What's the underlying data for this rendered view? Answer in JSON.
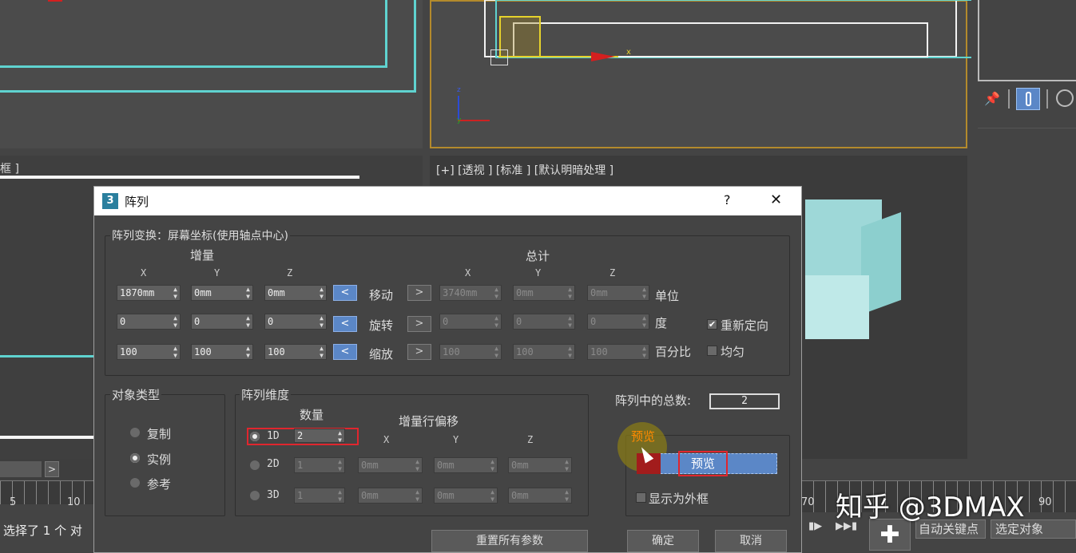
{
  "viewports": {
    "bottom_left_label": "框 ]",
    "persp_label": "[+] [透视 ] [标准 ] [默认明暗处理 ]",
    "axis_x": "x",
    "axis_z": "z",
    "axis_y": "y"
  },
  "timeline": {
    "ticks": [
      "5",
      "10",
      "70",
      "90"
    ]
  },
  "status": {
    "selection_text": "选择了 1 个 对",
    "auto_key": "自动关键点",
    "selected_object": "选定对象"
  },
  "watermark": "知乎 @3DMAX",
  "dialog": {
    "title": "阵列",
    "help": "?",
    "close": "✕",
    "transform_title": "阵列变换：屏幕坐标(使用轴点中心)",
    "incremental_label": "增量",
    "totals_label": "总计",
    "axes": [
      "X",
      "Y",
      "Z"
    ],
    "rows": [
      {
        "label": "移动",
        "inc": [
          "1870mm",
          "0mm",
          "0mm"
        ],
        "total": [
          "3740mm",
          "0mm",
          "0mm"
        ],
        "unit": "单位",
        "option": "重新定向",
        "option_checked": true
      },
      {
        "label": "旋转",
        "inc": [
          "0",
          "0",
          "0"
        ],
        "total": [
          "0",
          "0",
          "0"
        ],
        "unit": "度",
        "option": "均匀",
        "option_checked": false
      },
      {
        "label": "缩放",
        "inc": [
          "100",
          "100",
          "100"
        ],
        "total": [
          "100",
          "100",
          "100"
        ],
        "unit": "百分比",
        "option": "",
        "option_checked": false
      }
    ],
    "arrow_left": "<",
    "arrow_right": ">",
    "object_type": {
      "title": "对象类型",
      "options": [
        "复制",
        "实例",
        "参考"
      ],
      "selected": "实例"
    },
    "dimensions": {
      "title": "阵列维度",
      "count_label": "数量",
      "offset_label": "增量行偏移",
      "axes": [
        "X",
        "Y",
        "Z"
      ],
      "rows": [
        {
          "label": "1D",
          "count": "2",
          "offsets": []
        },
        {
          "label": "2D",
          "count": "1",
          "offsets": [
            "0mm",
            "0mm",
            "0mm"
          ]
        },
        {
          "label": "3D",
          "count": "1",
          "offsets": [
            "0mm",
            "0mm",
            "0mm"
          ]
        }
      ],
      "selected": "1D"
    },
    "total_in_array_label": "阵列中的总数:",
    "total_in_array_value": "2",
    "preview": {
      "title": "预览",
      "button": "预览",
      "display_as_box": "显示为外框",
      "display_as_box_checked": false
    },
    "reset_button": "重置所有参数",
    "ok_button": "确定",
    "cancel_button": "取消"
  },
  "colors": {
    "accent_blue": "#5b87c7",
    "highlight_red": "#e0262e",
    "viewport_yellow": "#c8a030",
    "cyan_line": "#5fd3d0",
    "preview_orange": "#ff8a00"
  }
}
